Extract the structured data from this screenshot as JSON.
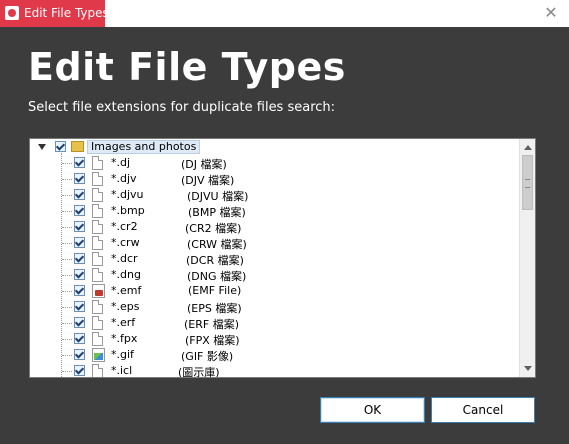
{
  "window": {
    "title": "Edit File Types",
    "close_glyph": "✕"
  },
  "header": {
    "title": "Edit File Types",
    "subtitle": "Select file extensions for duplicate files search:"
  },
  "tree": {
    "root": {
      "label": "Images and photos",
      "checked": true,
      "expanded": true
    },
    "items": [
      {
        "ext": "*.dj",
        "desc": "(DJ 檔案)",
        "icon": "file-icon",
        "checked": true
      },
      {
        "ext": "*.djv",
        "desc": "(DJV 檔案)",
        "icon": "file-icon",
        "checked": true
      },
      {
        "ext": "*.djvu",
        "desc": "(DJVU 檔案)",
        "icon": "file-icon",
        "checked": true
      },
      {
        "ext": "*.bmp",
        "desc": "(BMP 檔案)",
        "icon": "file-icon",
        "checked": true
      },
      {
        "ext": "*.cr2",
        "desc": "(CR2 檔案)",
        "icon": "file-icon",
        "checked": true
      },
      {
        "ext": "*.crw",
        "desc": "(CRW 檔案)",
        "icon": "file-icon",
        "checked": true
      },
      {
        "ext": "*.dcr",
        "desc": "(DCR 檔案)",
        "icon": "file-icon",
        "checked": true
      },
      {
        "ext": "*.dng",
        "desc": "(DNG 檔案)",
        "icon": "file-icon",
        "checked": true
      },
      {
        "ext": "*.emf",
        "desc": "(EMF File)",
        "icon": "emf-icon",
        "checked": true
      },
      {
        "ext": "*.eps",
        "desc": "(EPS 檔案)",
        "icon": "file-icon",
        "checked": true
      },
      {
        "ext": "*.erf",
        "desc": "(ERF 檔案)",
        "icon": "file-icon",
        "checked": true
      },
      {
        "ext": "*.fpx",
        "desc": "(FPX 檔案)",
        "icon": "file-icon",
        "checked": true
      },
      {
        "ext": "*.gif",
        "desc": "(GIF 影像)",
        "icon": "image-icon",
        "checked": true
      },
      {
        "ext": "*.icl",
        "desc": "(圖示庫)",
        "icon": "file-icon",
        "checked": true
      }
    ]
  },
  "buttons": {
    "ok": "OK",
    "cancel": "Cancel"
  },
  "colors": {
    "background": "#3c3c3c",
    "accent": "#e0394a",
    "button_border": "#3c7fb1"
  }
}
